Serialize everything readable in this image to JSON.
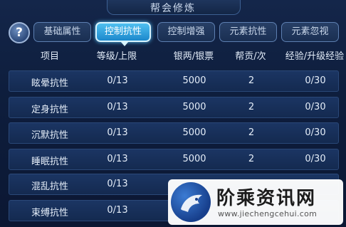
{
  "window": {
    "title": "帮会修炼",
    "help_label": "?"
  },
  "tabs": [
    {
      "label": "基础属性",
      "active": false
    },
    {
      "label": "控制抗性",
      "active": true
    },
    {
      "label": "控制增强",
      "active": false
    },
    {
      "label": "元素抗性",
      "active": false
    },
    {
      "label": "元素忽视",
      "active": false
    }
  ],
  "table": {
    "headers": [
      "项目",
      "等级/上限",
      "银两/银票",
      "帮贡/次",
      "经验/升级经验"
    ],
    "rows": [
      {
        "name": "眩晕抗性",
        "level": "0/13",
        "silver": "5000",
        "contribution": "2",
        "exp": "0/30"
      },
      {
        "name": "定身抗性",
        "level": "0/13",
        "silver": "5000",
        "contribution": "2",
        "exp": "0/30"
      },
      {
        "name": "沉默抗性",
        "level": "0/13",
        "silver": "5000",
        "contribution": "2",
        "exp": "0/30"
      },
      {
        "name": "睡眠抗性",
        "level": "0/13",
        "silver": "5000",
        "contribution": "2",
        "exp": "0/30"
      },
      {
        "name": "混乱抗性",
        "level": "0/13",
        "silver": "",
        "contribution": "",
        "exp": ""
      },
      {
        "name": "束缚抗性",
        "level": "0/13",
        "silver": "",
        "contribution": "",
        "exp": ""
      }
    ]
  },
  "watermark": {
    "brand": "阶乘资讯网",
    "url": "www.jiechengcehui.com"
  },
  "colors": {
    "background": "#0c1a33",
    "row": "#1b3563",
    "active_tab": "#4fc0f0",
    "tab_border": "#5d7fb1"
  }
}
